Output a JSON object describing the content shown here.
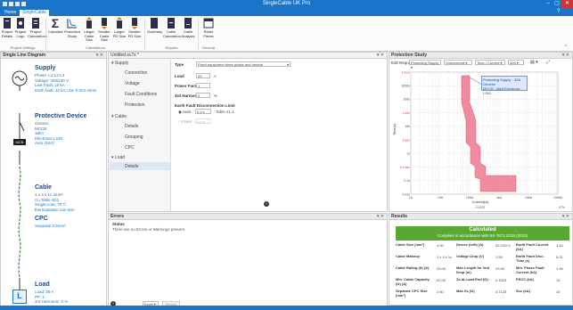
{
  "app": {
    "title": "SingleCable UK Pro"
  },
  "tabs": [
    "Home",
    "SingleCable"
  ],
  "ribbon": {
    "buttons": [
      {
        "label": "Project Details",
        "name": "project-details-button"
      },
      {
        "label": "Project Logo",
        "name": "project-logo-button"
      },
      {
        "label": "Project Calculations",
        "name": "project-calculations-button"
      },
      {
        "label": "Calculate",
        "name": "calculate-button"
      },
      {
        "label": "Protection Study",
        "name": "protection-study-button"
      },
      {
        "label": "Larger Cable Size",
        "name": "larger-cable-size-button"
      },
      {
        "label": "Smaller Cable Size",
        "name": "smaller-cable-size-button"
      },
      {
        "label": "Larger PD Size",
        "name": "larger-pd-size-button"
      },
      {
        "label": "Smaller PD Size",
        "name": "smaller-pd-size-button"
      },
      {
        "label": "Summary",
        "name": "summary-button"
      },
      {
        "label": "Cable Calculation",
        "name": "cable-calculation-button"
      },
      {
        "label": "Cable Analysis",
        "name": "cable-analysis-button"
      },
      {
        "label": "Reset Panes",
        "name": "reset-panes-button"
      }
    ],
    "groups": [
      "Project Settings",
      "Calculations",
      "Reports",
      "General"
    ]
  },
  "sld": {
    "title": "Single Line Diagram",
    "supply": {
      "heading": "Supply",
      "lines": [
        "Phase: L1-L2-L3",
        "Voltage: 400/230 V",
        "Line Fault: 10 kA",
        "Earth fault: 10 kA / Ze: 0.023 ohms"
      ]
    },
    "protective": {
      "heading": "Protective Device",
      "lines": [
        "Generic",
        "MCCB",
        "16kA",
        "Electronic LSIG",
        "Auto (32A)"
      ],
      "badge": "MCB"
    },
    "cable": {
      "heading": "Cable",
      "lines": [
        "1 x 4 x 1c 4mm²",
        "Cu Table 4D1",
        "Single-core, 70°C",
        "thermoplastic non-arm"
      ]
    },
    "cpc": {
      "heading": "CPC",
      "lines": [
        "Separate 2.5mm²"
      ]
    },
    "load": {
      "heading": "Load",
      "lines": [
        "Load: 29 A",
        "PF: 1",
        "3rd Harmonic: 0 %"
      ],
      "badge": "L"
    }
  },
  "editor": {
    "tab": "Untitled.sc7x *",
    "nav": [
      {
        "label": "Supply",
        "type": "head"
      },
      {
        "label": "Connection",
        "type": "sub"
      },
      {
        "label": "Voltage",
        "type": "sub"
      },
      {
        "label": "Fault Conditions",
        "type": "sub"
      },
      {
        "label": "Protection",
        "type": "sub"
      },
      {
        "label": "Cable",
        "type": "head"
      },
      {
        "label": "Details",
        "type": "sub"
      },
      {
        "label": "Grouping",
        "type": "sub"
      },
      {
        "label": "CPC",
        "type": "sub"
      },
      {
        "label": "Load",
        "type": "head"
      },
      {
        "label": "Details",
        "type": "sub",
        "selected": true
      }
    ],
    "fields": {
      "type_label": "Type",
      "type_value": "Fixed equipment three phase and neutral",
      "load_label": "Load",
      "load_value": "29",
      "load_unit": "A",
      "pf_label": "Power Factor",
      "pf_value": "1",
      "harm_label": "3rd Harmonic",
      "harm_value": "0",
      "harm_unit": "%",
      "edl_label": "Earth Fault Disconnection Limit",
      "auto_label": "Auto",
      "auto_value": "0.4 s",
      "auto_ref": "Table 41.1",
      "fixed_label": "Fixed",
      "fixed_value": "0.4 s"
    }
  },
  "errors": {
    "title": "Errors",
    "status_label": "Status",
    "message": "There are no Errors or Warnings present.",
    "export": "Excel",
    "search": "Search"
  },
  "study": {
    "title": "Protection Study",
    "toolbar": {
      "edit_label": "Edit Request",
      "req": "Protecting Supply",
      "mode": "Overcurrent",
      "axis": "Time / Current",
      "scale": "400"
    },
    "ylabel": "Time(s)",
    "xlabel": "Current(A)",
    "yticks": [
      "1 hour",
      "1000s",
      "100s",
      "1 min",
      "10s",
      "5 sec",
      "1s",
      "0.4 sec",
      "0.1s",
      "0.01s"
    ],
    "xticks": [
      "1A",
      "10A",
      "100A",
      "1kA",
      "10kA",
      "100kA"
    ],
    "tooltip": [
      "Protecting Supply - 32A",
      "Generic",
      "MCCB, 16kA Electronic LSIG"
    ],
    "footer": "0.0023",
    "zoom": "37%"
  },
  "results": {
    "title": "Results",
    "banner_title": "Calculated",
    "banner_sub": "Complies in accordance with BS 7671:2018 (2022)",
    "rows": [
      [
        {
          "l": "Cable Size (mm²)",
          "v": "4.00"
        },
        {
          "l": "Device (In/It) (A)",
          "v": "32.0/32.0"
        },
        {
          "l": "Earth Fault Current (kA)",
          "v": "1.44"
        }
      ],
      [
        {
          "l": "Cable Makeup",
          "v": "1 x 4 x 1c"
        },
        {
          "l": "Voltage Drop (V)",
          "v": "1.59"
        },
        {
          "l": "Earth Fault Disc. Time (s)",
          "v": "0.01"
        }
      ],
      [
        {
          "l": "Cable Rating (It) (A)",
          "v": "33.00"
        },
        {
          "l": "Max Length for Volt Drop (m)",
          "v": "29.90"
        },
        {
          "l": "Min. Phase Fault Current (kA)",
          "v": "1.94"
        }
      ],
      [
        {
          "l": "Min. Cable Capacity (Iz) (A)",
          "v": "32.00"
        },
        {
          "l": "Zs at Load End (Ω)",
          "v": "0.1523"
        },
        {
          "l": "PSCC (kA)",
          "v": "10"
        }
      ],
      [
        {
          "l": "Separate CPC Size (mm²)",
          "v": "2.50"
        },
        {
          "l": "Max Zs (Ω)",
          "v": "3.7123"
        },
        {
          "l": "Scc (kA)",
          "v": "10"
        }
      ]
    ]
  },
  "colors": {
    "accent": "#1a74c8",
    "pass": "#59a832",
    "curve": "#e8506a",
    "tooltip": "#dde8ff"
  }
}
